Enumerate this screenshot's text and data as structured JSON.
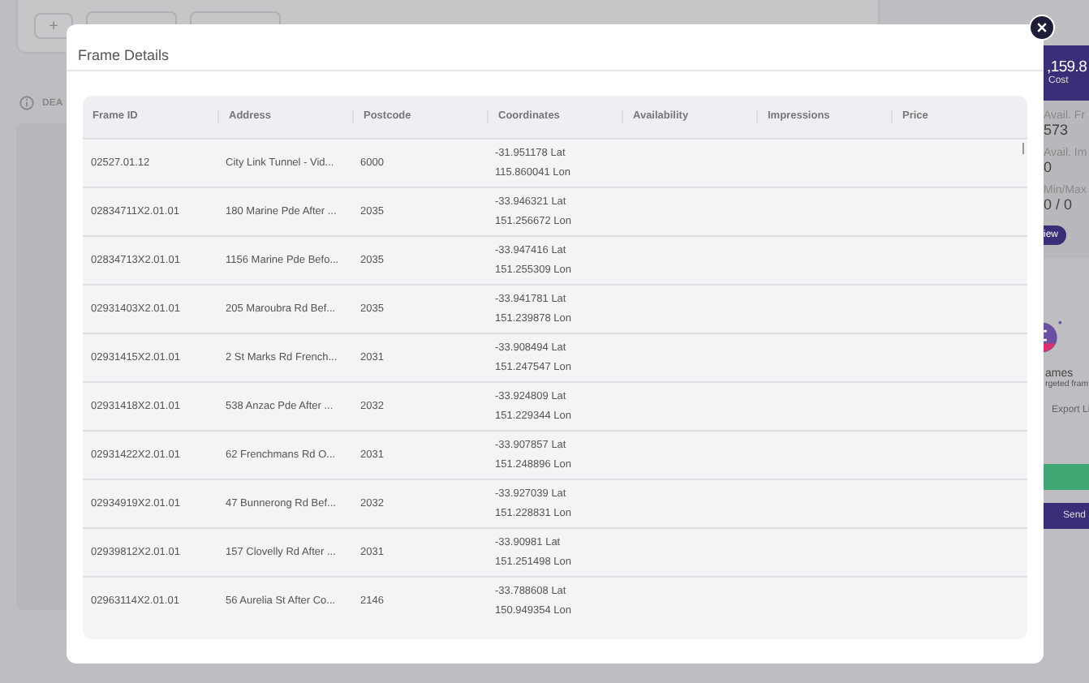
{
  "background": {
    "add_button": "+",
    "section_label": "DEA",
    "cost_value": ",159.8",
    "cost_label": "Cost",
    "stats": [
      {
        "label": "Avail. Fr",
        "value": "573"
      },
      {
        "label": "Avail. Im",
        "value": "0"
      },
      {
        "label": "Min/Max",
        "value": "0 / 0"
      }
    ],
    "view_button": "iew",
    "frames_title": "ames",
    "frames_subtitle": "rgeted fram",
    "export_link": "Export Li",
    "send_button": "Send"
  },
  "modal": {
    "title": "Frame Details",
    "table": {
      "columns": [
        "Frame ID",
        "Address",
        "Postcode",
        "Coordinates",
        "Availability",
        "Impressions",
        "Price"
      ],
      "rows": [
        {
          "frame_id": "02527.01.12",
          "address": "City Link Tunnel - Vid...",
          "postcode": "6000",
          "lat": "-31.951178 Lat",
          "lon": "115.860041 Lon"
        },
        {
          "frame_id": "02834711X2.01.01",
          "address": "180 Marine Pde After ...",
          "postcode": "2035",
          "lat": "-33.946321 Lat",
          "lon": "151.256672 Lon"
        },
        {
          "frame_id": "02834713X2.01.01",
          "address": "1156 Marine Pde Befo...",
          "postcode": "2035",
          "lat": "-33.947416 Lat",
          "lon": "151.255309 Lon"
        },
        {
          "frame_id": "02931403X2.01.01",
          "address": "205 Maroubra Rd Bef...",
          "postcode": "2035",
          "lat": "-33.941781 Lat",
          "lon": "151.239878 Lon"
        },
        {
          "frame_id": "02931415X2.01.01",
          "address": "2 St Marks Rd French...",
          "postcode": "2031",
          "lat": "-33.908494 Lat",
          "lon": "151.247547 Lon"
        },
        {
          "frame_id": "02931418X2.01.01",
          "address": "538 Anzac Pde After ...",
          "postcode": "2032",
          "lat": "-33.924809 Lat",
          "lon": "151.229344 Lon"
        },
        {
          "frame_id": "02931422X2.01.01",
          "address": "62 Frenchmans Rd O...",
          "postcode": "2031",
          "lat": "-33.907857 Lat",
          "lon": "151.248896 Lon"
        },
        {
          "frame_id": "02934919X2.01.01",
          "address": "47 Bunnerong Rd Bef...",
          "postcode": "2032",
          "lat": "-33.927039 Lat",
          "lon": "151.228831 Lon"
        },
        {
          "frame_id": "02939812X2.01.01",
          "address": "157 Clovelly Rd After ...",
          "postcode": "2031",
          "lat": "-33.90981 Lat",
          "lon": "151.251498 Lon"
        },
        {
          "frame_id": "02963114X2.01.01",
          "address": "56 Aurelia St After Co...",
          "postcode": "2146",
          "lat": "-33.788608 Lat",
          "lon": "150.949354 Lon"
        }
      ]
    }
  }
}
